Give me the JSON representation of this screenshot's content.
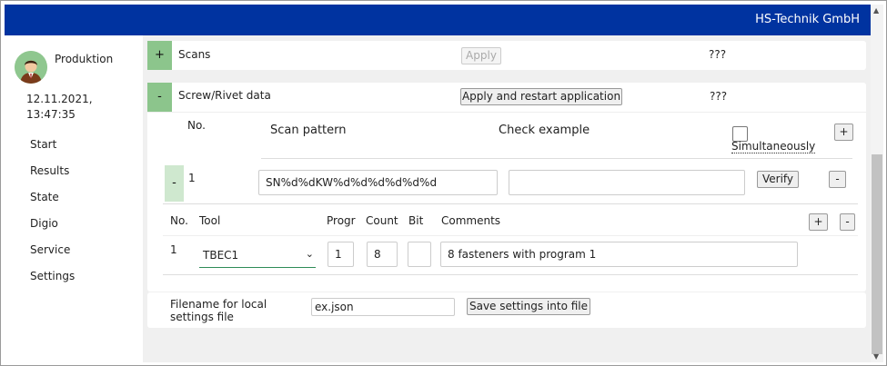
{
  "header": {
    "brand": "HS-Technik GmbH"
  },
  "sidebar": {
    "user": "Produktion",
    "date": "12.11.2021,",
    "time": "13:47:35",
    "items": [
      {
        "label": "Start"
      },
      {
        "label": "Results"
      },
      {
        "label": "State"
      },
      {
        "label": "Digio"
      },
      {
        "label": "Service"
      },
      {
        "label": "Settings"
      }
    ]
  },
  "scans": {
    "toggle": "+",
    "title": "Scans",
    "apply_label": "Apply",
    "status": "???"
  },
  "screw": {
    "toggle": "-",
    "title": "Screw/Rivet data",
    "apply_label": "Apply and restart application",
    "status": "???",
    "headers": {
      "no": "No.",
      "scan_pattern": "Scan pattern",
      "check_example": "Check example",
      "simultaneously": "Simultaneously"
    },
    "add_label": "+",
    "row": {
      "toggle": "-",
      "no": "1",
      "scan_pattern": "SN%d%dKW%d%d%d%d%d%d",
      "check_example": "",
      "verify_label": "Verify",
      "remove_label": "-"
    },
    "tools": {
      "headers": {
        "no": "No.",
        "tool": "Tool",
        "progr": "Progr",
        "count": "Count",
        "bit": "Bit",
        "comments": "Comments"
      },
      "add_label": "+",
      "remove_label": "-",
      "row": {
        "no": "1",
        "tool": "TBEC1",
        "progr": "1",
        "count": "8",
        "bit": "",
        "comments": "8 fasteners with program 1"
      }
    }
  },
  "local_settings": {
    "label_line1": "Filename for local",
    "label_line2": "settings file",
    "filename": "ex.json",
    "save_label": "Save settings into file"
  }
}
